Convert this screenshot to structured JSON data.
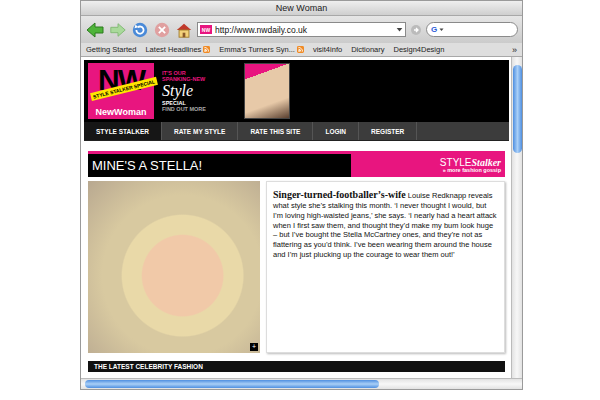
{
  "window": {
    "title": "New Woman"
  },
  "toolbar": {
    "url": "http://www.nwdaily.co.uk",
    "favicon": "NW",
    "search_engine": "G"
  },
  "bookmarks": [
    {
      "label": "Getting Started",
      "feed": false
    },
    {
      "label": "Latest Headlines",
      "feed": true
    },
    {
      "label": "Emma's Turners Syn...",
      "feed": true
    },
    {
      "label": "visit4info",
      "feed": false
    },
    {
      "label": "Dictionary",
      "feed": false
    },
    {
      "label": "Design4Design",
      "feed": false
    }
  ],
  "bookmarks_more": "»",
  "header": {
    "logo": {
      "badge": "STYLE STALKER SPECIAL",
      "initials": "NW",
      "name": "NewWoman"
    },
    "promo": {
      "lead": "IT'S OUR",
      "highlight": "SPANKING-NEW",
      "script": "Style",
      "word": "SPECIAL",
      "link": "FIND OUT MORE"
    }
  },
  "nav": [
    {
      "label": "STYLE STALKER",
      "selected": true
    },
    {
      "label": "RATE MY STYLE",
      "selected": false
    },
    {
      "label": "RATE THIS SITE",
      "selected": false
    },
    {
      "label": "LOGIN",
      "selected": false
    },
    {
      "label": "REGISTER",
      "selected": false
    }
  ],
  "article": {
    "title": "MINE'S A STELLA!",
    "section": {
      "label": "STYLE",
      "script": "Stalker",
      "link": "» more fashion gossip"
    },
    "enlarge": "+",
    "headline": "Singer-turned-footballer’s-wife",
    "body": "Louise Redknapp reveals what style she’s stalking this month. ‘I never thought I would, but I’m loving high-waisted jeans,’ she says. ‘I nearly had a heart attack when I first saw them, and thought they’d make my bum look huge – but I’ve bought the Stella McCartney ones, and they’re not as flattering as you’d think. I’ve been wearing them around the house and I’m just plucking up the courage to wear them out!’"
  },
  "footer_bar": "THE LATEST CELEBRITY FASHION",
  "scrollbars": {
    "vertical": {
      "level": 0.28
    },
    "horizontal": {
      "level": 0.68
    }
  }
}
